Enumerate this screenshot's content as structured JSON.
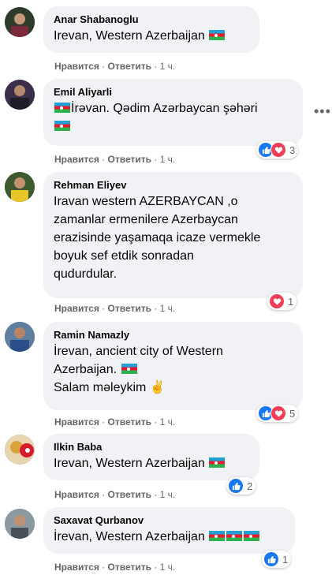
{
  "actions": {
    "like": "Нравится",
    "reply": "Ответить",
    "sep": "·",
    "time": "1 ч."
  },
  "comments": [
    {
      "author": "Anar Shabanoglu",
      "lines": [
        "Irevan, Western Azerbaijan"
      ],
      "reactions": null
    },
    {
      "author": "Emil Aliyarli",
      "lines": [
        "İrəvan. Qədim Azərbaycan şəhəri"
      ],
      "reactions": {
        "types": [
          "like",
          "love"
        ],
        "count": "3"
      }
    },
    {
      "author": "Rehman Eliyev",
      "lines": [
        "Iravan western AZERBAYCAN ,o",
        "zamanlar ermenilere Azerbaycan",
        "erazisinde yaşamaqa icaze vermekle",
        "boyuk sef etdik sonradan",
        "qudurdular."
      ],
      "reactions": {
        "types": [
          "love"
        ],
        "count": "1"
      }
    },
    {
      "author": "Ramin Namazly",
      "lines": [
        "İrevan, ancient city of Western",
        "Azerbaijan.",
        "Salam məleykim ✌"
      ],
      "reactions": {
        "types": [
          "like",
          "love"
        ],
        "count": "5"
      }
    },
    {
      "author": "Ilkin Baba",
      "lines": [
        "Irevan, Western Azerbaijan"
      ],
      "reactions": {
        "types": [
          "like"
        ],
        "count": "2"
      }
    },
    {
      "author": "Saxavat Qurbanov",
      "lines": [
        "İrevan, Western Azerbaijan"
      ],
      "reactions": {
        "types": [
          "like"
        ],
        "count": "1"
      }
    }
  ],
  "icons": {
    "more": "more-options-icon",
    "flag": "azerbaijan-flag-icon"
  }
}
